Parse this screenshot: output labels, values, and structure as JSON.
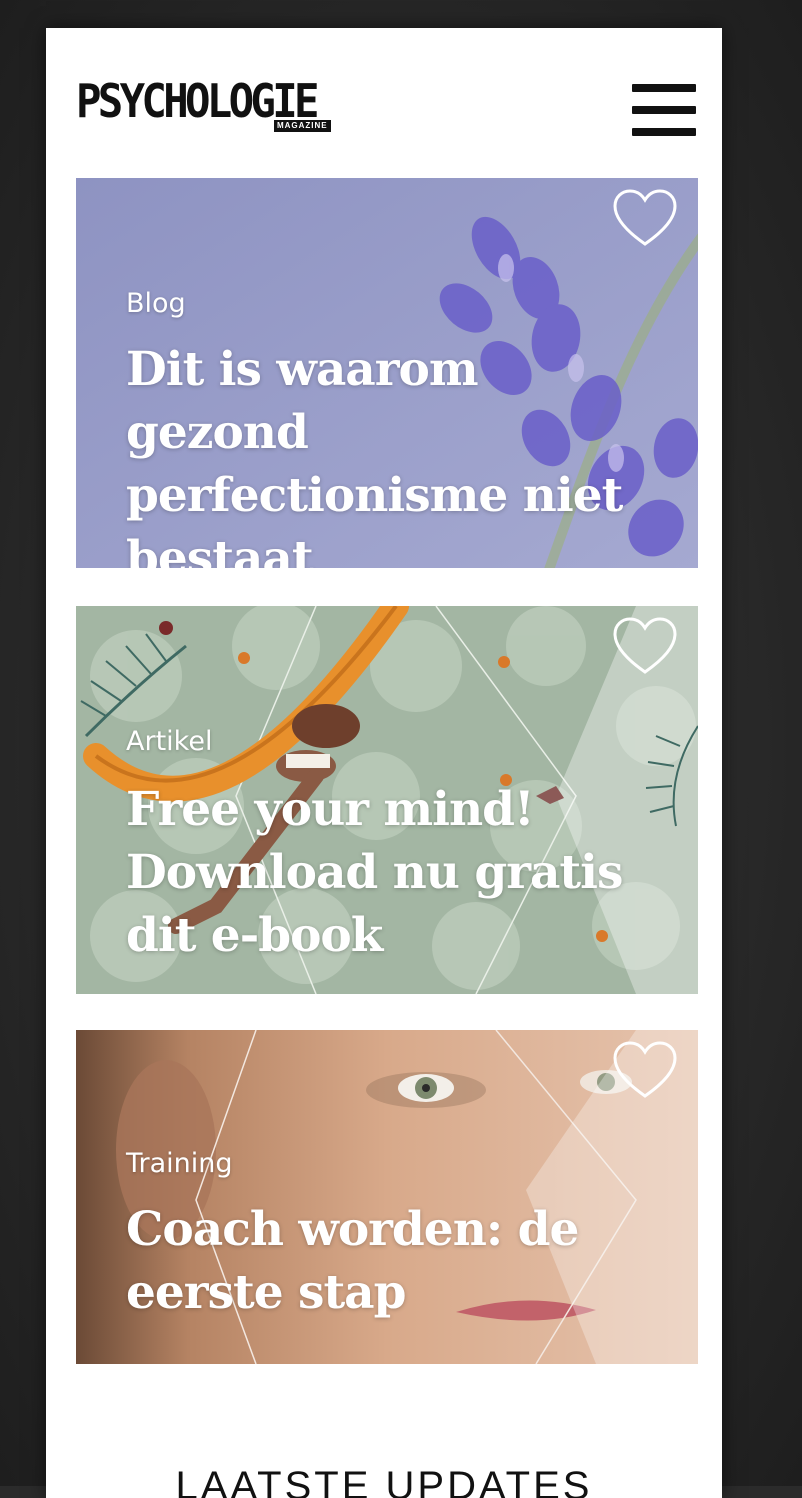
{
  "brand": {
    "logo_text": "PSYCHOLOGIE",
    "logo_sub": "MAGAZINE"
  },
  "header": {
    "menu_icon": "hamburger-menu-icon"
  },
  "cards": [
    {
      "category": "Blog",
      "title": "Dit is waarom gezond perfectionisme niet bestaat",
      "icon": "heart-outline-icon"
    },
    {
      "category": "Artikel",
      "title": "Free your mind! Download nu gratis dit e-book",
      "icon": "heart-outline-icon"
    },
    {
      "category": "Training",
      "title": "Coach worden: de eerste stap",
      "icon": "heart-outline-icon"
    }
  ],
  "sections": {
    "latest_heading": "LAATSTE UPDATES"
  },
  "colors": {
    "card1_bg": "#9a9dc6",
    "card2_bg": "#9fb3a0",
    "card3_bg": "#c9a48a",
    "text_on_image": "#ffffff"
  }
}
